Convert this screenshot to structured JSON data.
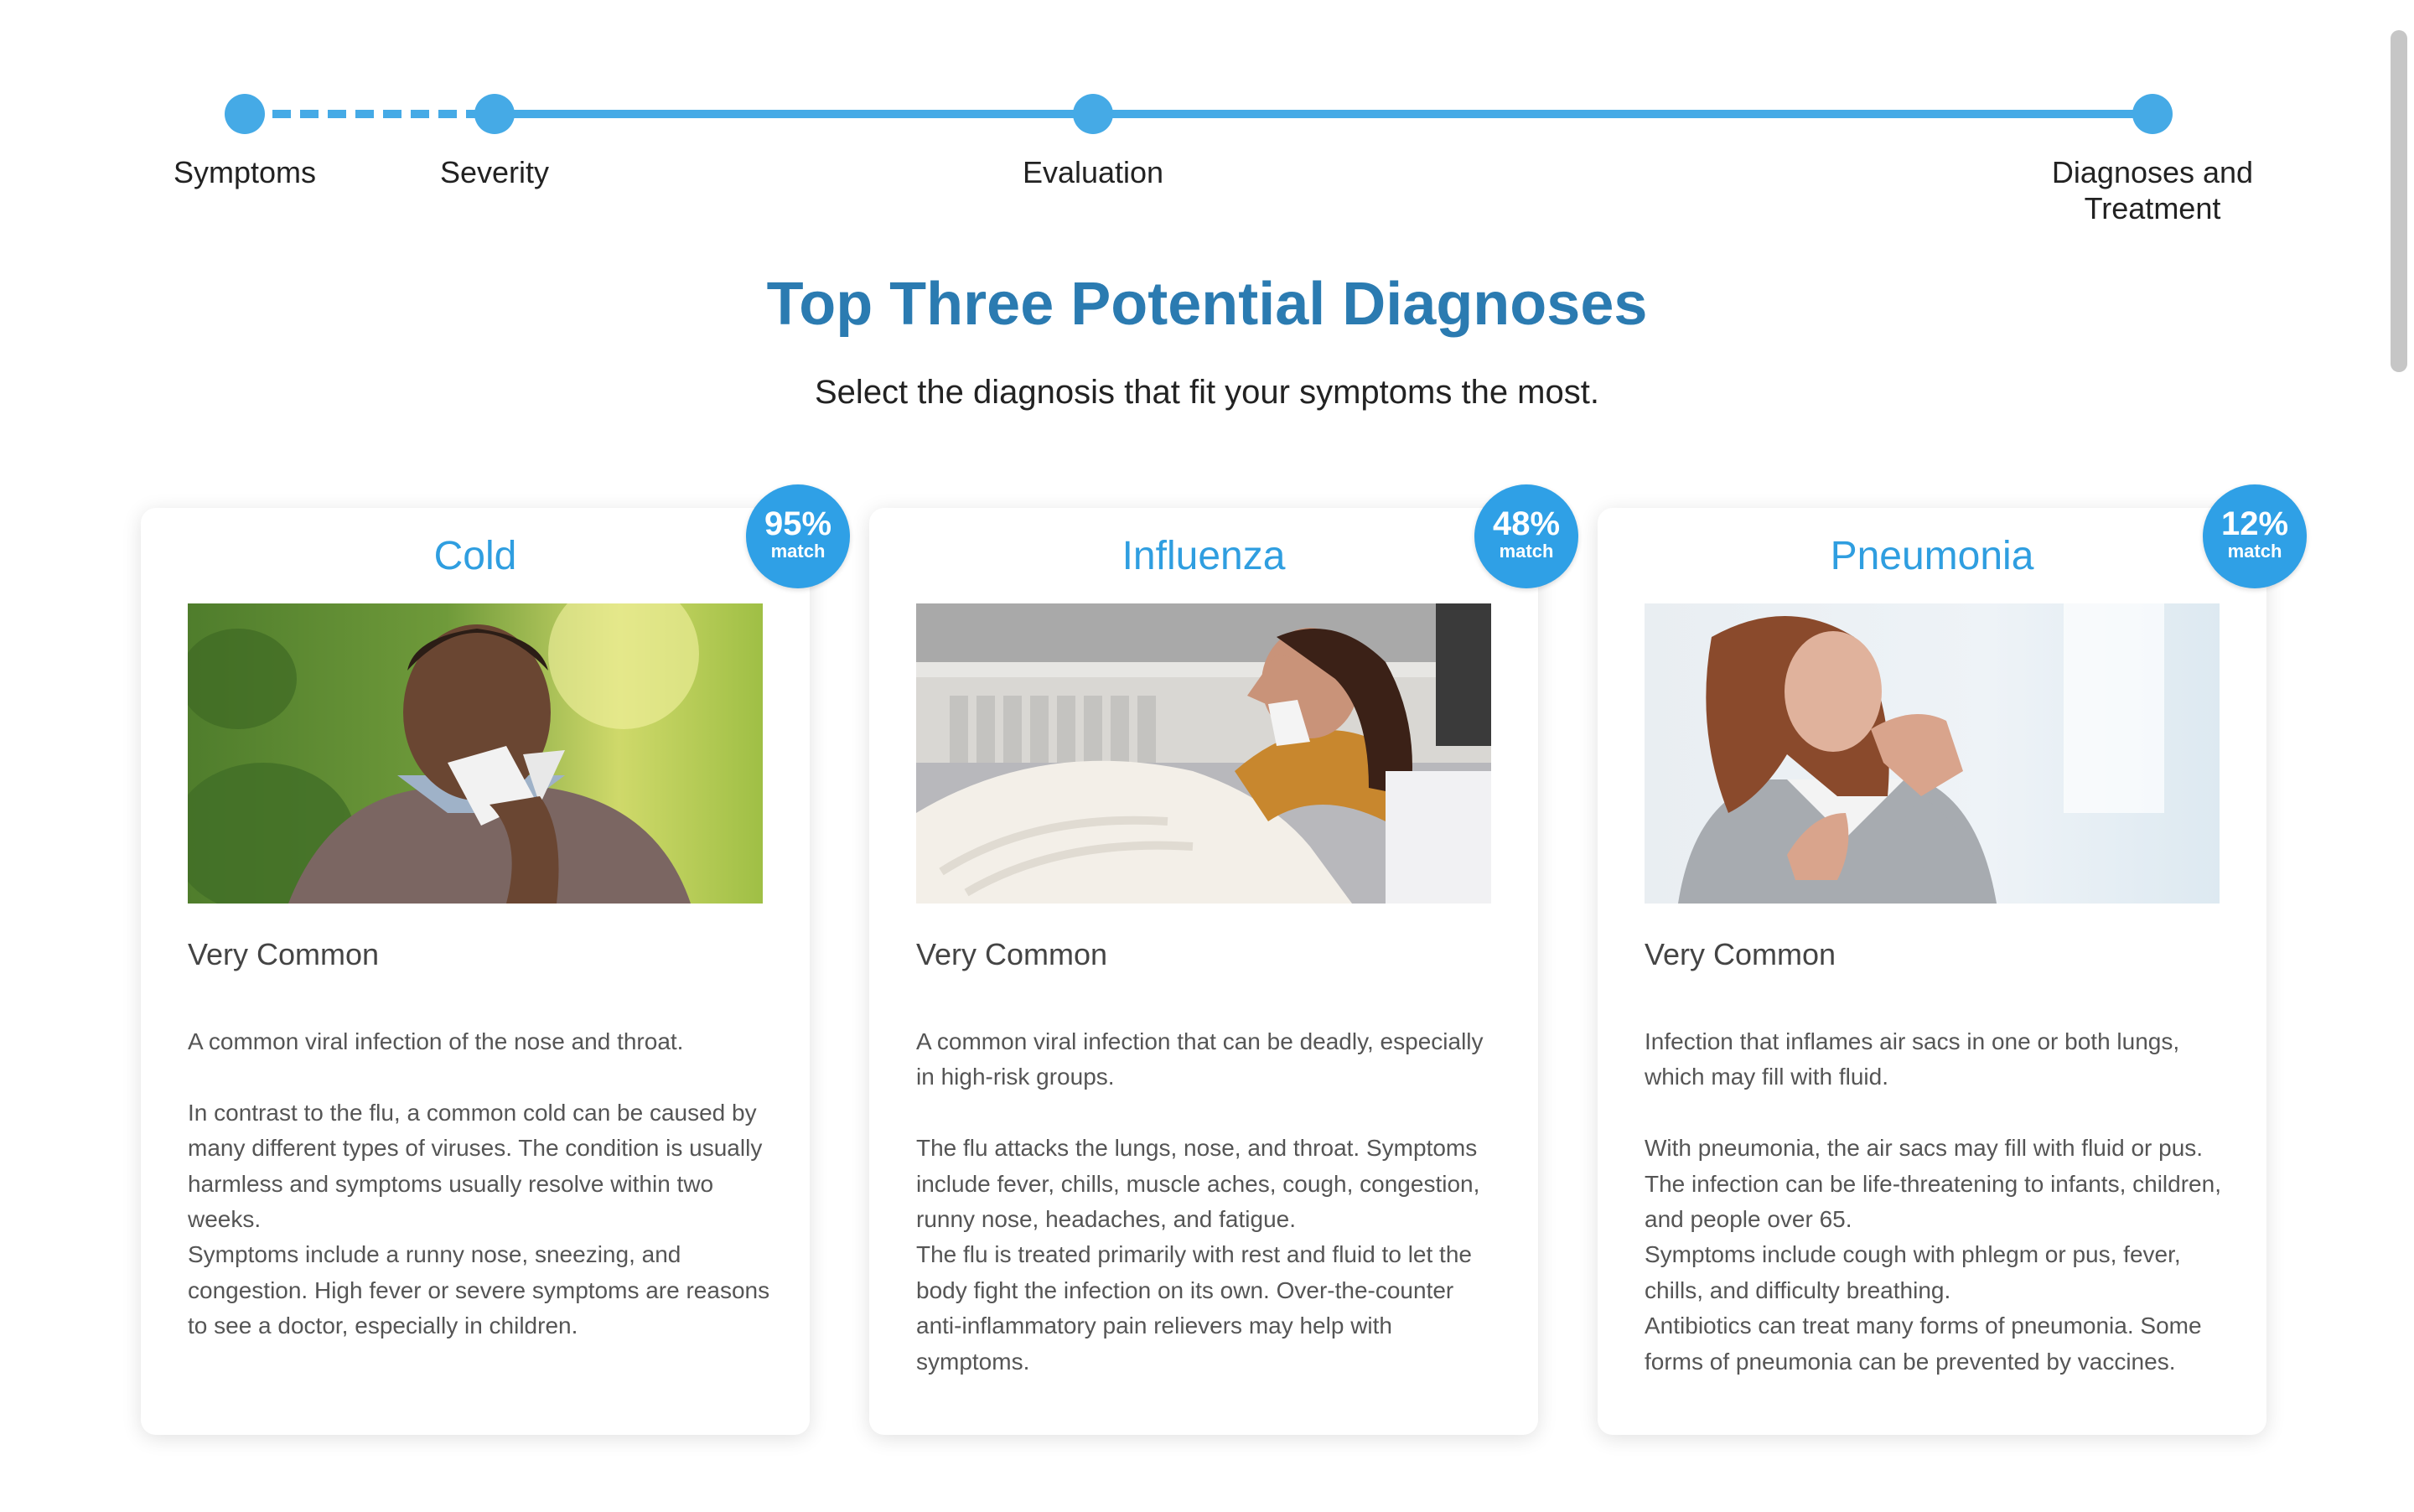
{
  "stepper": {
    "steps": [
      {
        "label": "Symptoms"
      },
      {
        "label": "Severity"
      },
      {
        "label": "Evaluation"
      },
      {
        "label": "Diagnoses and Treatment"
      }
    ]
  },
  "title": "Top Three Potential Diagnoses",
  "subtitle": "Select the diagnosis that fit your symptoms the most.",
  "match_label": "match",
  "cards": [
    {
      "name": "Cold",
      "match": "95%",
      "frequency": "Very Common",
      "paragraphs": [
        "A common viral infection of the nose and throat.",
        "In contrast to the flu, a common cold can be caused by many different types of viruses. The condition is usually harmless and symptoms usually resolve within two weeks.",
        "Symptoms include a runny nose, sneezing, and congestion. High fever or severe symptoms are reasons to see a doctor, especially in children."
      ]
    },
    {
      "name": "Influenza",
      "match": "48%",
      "frequency": "Very Common",
      "paragraphs": [
        "A common viral infection that can be deadly, especially in high-risk groups.",
        "The flu attacks the lungs, nose, and throat. Symptoms include fever, chills, muscle aches, cough, congestion, runny nose, headaches, and fatigue.",
        "The flu is treated primarily with rest and fluid to let the body fight the infection on its own. Over-the-counter anti-inflammatory pain relievers may help with symptoms."
      ]
    },
    {
      "name": "Pneumonia",
      "match": "12%",
      "frequency": "Very Common",
      "paragraphs": [
        "Infection that inflames air sacs in one or both lungs, which may fill with fluid.",
        "With pneumonia, the air sacs may fill with fluid or pus. The infection can be life-threatening to infants, children, and people over 65.",
        "Symptoms include cough with phlegm or pus, fever, chills, and difficulty breathing.",
        "Antibiotics can treat many forms of pneumonia. Some forms of pneumonia can be prevented by vaccines."
      ]
    }
  ],
  "colors": {
    "accent": "#45aae6",
    "title": "#2b7bb1",
    "card_title": "#2f9ee0",
    "badge": "#2fa0e6"
  }
}
